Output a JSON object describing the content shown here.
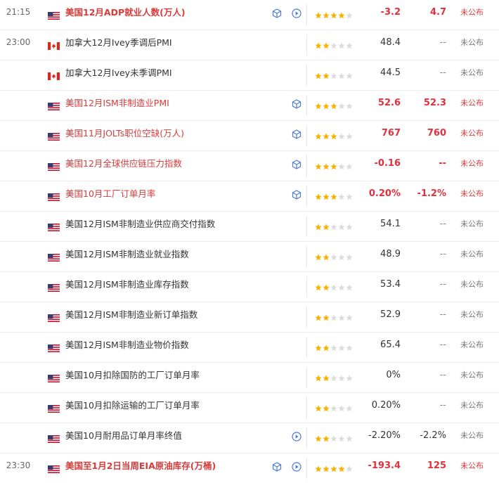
{
  "status_label": "未公布",
  "dash": "--",
  "rows": [
    {
      "time": "21:15",
      "country": "us",
      "name": "美国12月ADP就业人数(万人)",
      "important": true,
      "bold": true,
      "cube": true,
      "play": true,
      "stars": 4,
      "actual": "-3.2",
      "prev": "4.7",
      "highlight": true,
      "status_style": "pub"
    },
    {
      "time": "23:00",
      "country": "ca",
      "name": "加拿大12月Ivey季调后PMI",
      "important": false,
      "bold": false,
      "cube": false,
      "play": false,
      "stars": 2,
      "actual": "48.4",
      "prev": "--",
      "highlight": false,
      "status_style": "unpub"
    },
    {
      "time": "",
      "country": "ca",
      "name": "加拿大12月Ivey未季调PMI",
      "important": false,
      "bold": false,
      "cube": false,
      "play": false,
      "stars": 2,
      "actual": "44.5",
      "prev": "--",
      "highlight": false,
      "status_style": "unpub"
    },
    {
      "time": "",
      "country": "us",
      "name": "美国12月ISM非制造业PMI",
      "important": true,
      "bold": false,
      "cube": true,
      "play": false,
      "stars": 3,
      "actual": "52.6",
      "prev": "52.3",
      "highlight": true,
      "status_style": "pub"
    },
    {
      "time": "",
      "country": "us",
      "name": "美国11月JOLTs职位空缺(万人)",
      "important": true,
      "bold": false,
      "cube": true,
      "play": false,
      "stars": 3,
      "actual": "767",
      "prev": "760",
      "highlight": true,
      "status_style": "pub"
    },
    {
      "time": "",
      "country": "us",
      "name": "美国12月全球供应链压力指数",
      "important": true,
      "bold": false,
      "cube": true,
      "play": false,
      "stars": 3,
      "actual": "-0.16",
      "prev": "--",
      "highlight": true,
      "status_style": "pub"
    },
    {
      "time": "",
      "country": "us",
      "name": "美国10月工厂订单月率",
      "important": true,
      "bold": false,
      "cube": true,
      "play": false,
      "stars": 3,
      "actual": "0.20%",
      "prev": "-1.2%",
      "highlight": true,
      "status_style": "pub"
    },
    {
      "time": "",
      "country": "us",
      "name": "美国12月ISM非制造业供应商交付指数",
      "important": false,
      "bold": false,
      "cube": false,
      "play": false,
      "stars": 2,
      "actual": "54.1",
      "prev": "--",
      "highlight": false,
      "status_style": "unpub"
    },
    {
      "time": "",
      "country": "us",
      "name": "美国12月ISM非制造业就业指数",
      "important": false,
      "bold": false,
      "cube": false,
      "play": false,
      "stars": 2,
      "actual": "48.9",
      "prev": "--",
      "highlight": false,
      "status_style": "unpub"
    },
    {
      "time": "",
      "country": "us",
      "name": "美国12月ISM非制造业库存指数",
      "important": false,
      "bold": false,
      "cube": false,
      "play": false,
      "stars": 2,
      "actual": "53.4",
      "prev": "--",
      "highlight": false,
      "status_style": "unpub"
    },
    {
      "time": "",
      "country": "us",
      "name": "美国12月ISM非制造业新订单指数",
      "important": false,
      "bold": false,
      "cube": false,
      "play": false,
      "stars": 2,
      "actual": "52.9",
      "prev": "--",
      "highlight": false,
      "status_style": "unpub"
    },
    {
      "time": "",
      "country": "us",
      "name": "美国12月ISM非制造业物价指数",
      "important": false,
      "bold": false,
      "cube": false,
      "play": false,
      "stars": 2,
      "actual": "65.4",
      "prev": "--",
      "highlight": false,
      "status_style": "unpub"
    },
    {
      "time": "",
      "country": "us",
      "name": "美国10月扣除国防的工厂订单月率",
      "important": false,
      "bold": false,
      "cube": false,
      "play": false,
      "stars": 2,
      "actual": "0%",
      "prev": "--",
      "highlight": false,
      "status_style": "unpub"
    },
    {
      "time": "",
      "country": "us",
      "name": "美国10月扣除运输的工厂订单月率",
      "important": false,
      "bold": false,
      "cube": false,
      "play": false,
      "stars": 2,
      "actual": "0.20%",
      "prev": "--",
      "highlight": false,
      "status_style": "unpub"
    },
    {
      "time": "",
      "country": "us",
      "name": "美国10月耐用品订单月率终值",
      "important": false,
      "bold": false,
      "cube": false,
      "play": true,
      "stars": 2,
      "actual": "-2.20%",
      "prev": "-2.2%",
      "highlight": false,
      "status_style": "unpub"
    },
    {
      "time": "23:30",
      "country": "us",
      "name": "美国至1月2日当周EIA原油库存(万桶)",
      "important": true,
      "bold": true,
      "cube": true,
      "play": true,
      "stars": 4,
      "actual": "-193.4",
      "prev": "125",
      "highlight": true,
      "status_style": "pub"
    }
  ],
  "colors": {
    "accent": "#e0313c",
    "star_on": "#f5b400",
    "star_off": "#dcdcdc",
    "icon_blue": "#4a7bd0"
  }
}
